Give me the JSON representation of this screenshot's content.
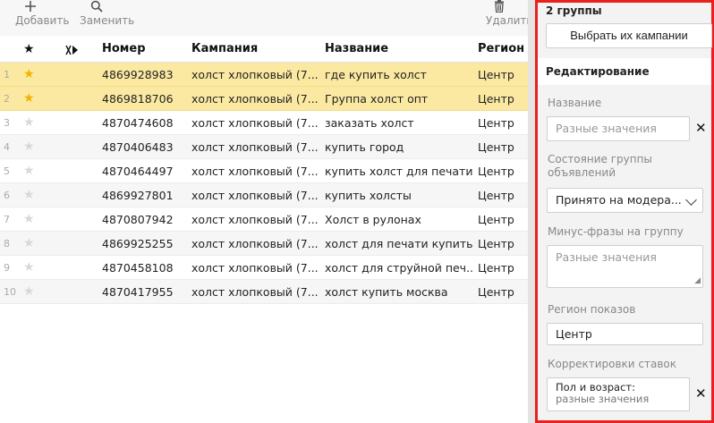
{
  "toolbar": {
    "add_label": "Добавить",
    "replace_label": "Заменить",
    "delete_label": "Удалить"
  },
  "table": {
    "headers": {
      "id": "Номер",
      "campaign": "Кампания",
      "name": "Название",
      "region": "Регион показов"
    },
    "rows": [
      {
        "num": "1",
        "starred": true,
        "id": "4869928983",
        "campaign": "холст хлопковый (7...",
        "name": "где купить холст",
        "region": "Центр"
      },
      {
        "num": "2",
        "starred": true,
        "id": "4869818706",
        "campaign": "холст хлопковый (7...",
        "name": "Группа холст опт",
        "region": "Центр"
      },
      {
        "num": "3",
        "starred": false,
        "id": "4870474608",
        "campaign": "холст хлопковый (7...",
        "name": "заказать холст",
        "region": "Центр"
      },
      {
        "num": "4",
        "starred": false,
        "id": "4870406483",
        "campaign": "холст хлопковый (7...",
        "name": "купить город",
        "region": "Центр"
      },
      {
        "num": "5",
        "starred": false,
        "id": "4870464497",
        "campaign": "холст хлопковый (7...",
        "name": "купить холст для печати",
        "region": "Центр"
      },
      {
        "num": "6",
        "starred": false,
        "id": "4869927801",
        "campaign": "холст хлопковый (7...",
        "name": "купить холсты",
        "region": "Центр"
      },
      {
        "num": "7",
        "starred": false,
        "id": "4870807942",
        "campaign": "холст хлопковый (7...",
        "name": "Холст в рулонах",
        "region": "Центр"
      },
      {
        "num": "8",
        "starred": false,
        "id": "4869925255",
        "campaign": "холст хлопковый (7...",
        "name": "холст для печати купить",
        "region": "Центр"
      },
      {
        "num": "9",
        "starred": false,
        "id": "4870458108",
        "campaign": "холст хлопковый (7...",
        "name": "холст для струйной печ...",
        "region": "Центр"
      },
      {
        "num": "10",
        "starred": false,
        "id": "4870417955",
        "campaign": "холст хлопковый (7...",
        "name": "холст купить москва",
        "region": "Центр"
      }
    ]
  },
  "panel": {
    "title": "2 группы",
    "choose_campaigns_label": "Выбрать их кампании",
    "edit_heading": "Редактирование",
    "name_label": "Название",
    "name_placeholder": "Разные значения",
    "state_label": "Состояние группы объявлений",
    "state_value": "Принято на модера...",
    "minus_label": "Минус-фразы на группу",
    "minus_placeholder": "Разные значения",
    "region_label": "Регион показов",
    "region_value": "Центр",
    "bids_label": "Корректировки ставок",
    "bids_line1": "Пол и возраст:",
    "bids_line2": "разные значения"
  },
  "icons": {
    "add": "plus-icon",
    "replace": "search-icon",
    "delete": "trash-icon",
    "star": "star-icon",
    "flag": "flag-icon",
    "clear": "close-icon",
    "dropdown": "chevron-down-icon"
  },
  "colors": {
    "selected_row": "#fbe9a2",
    "star_active": "#f0b400",
    "panel_border": "#e8201e"
  }
}
